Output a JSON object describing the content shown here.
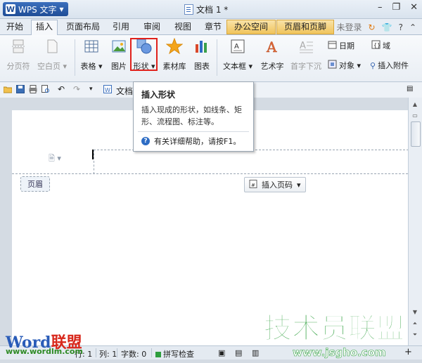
{
  "app": {
    "name": "WPS 文字",
    "doc_title": "文档 1 *"
  },
  "tabs": [
    {
      "label": "开始"
    },
    {
      "label": "插入"
    },
    {
      "label": "页面布局"
    },
    {
      "label": "引用"
    },
    {
      "label": "审阅"
    },
    {
      "label": "视图"
    },
    {
      "label": "章节"
    },
    {
      "label": "办公空间"
    },
    {
      "label": "页眉和页脚"
    }
  ],
  "account": {
    "login_label": "未登录"
  },
  "ribbon": {
    "page_break": "分页符",
    "blank_page": "空白页",
    "table": "表格",
    "picture": "图片",
    "shape": "形状",
    "material": "素材库",
    "chart": "图表",
    "textbox": "文本框",
    "wordart": "艺术字",
    "dropcap": "首字下沉",
    "date": "日期",
    "field": "域",
    "object": "对象",
    "attachment": "插入附件"
  },
  "quickbar": {
    "doc_tab_prefix": "文档"
  },
  "tooltip": {
    "title": "插入形状",
    "description": "插入现成的形状，如线条、矩形、流程图、标注等。",
    "help": "有关详细帮助，请按F1。"
  },
  "document": {
    "header_label": "页眉",
    "insert_page_number": "插入页码"
  },
  "status": {
    "line_label": "行: 1",
    "col_label": "列: 1",
    "word_count": "字数: 0",
    "spellcheck": "拼写检查"
  },
  "watermark": {
    "word_part1": "Word",
    "word_part2": "联盟",
    "url": "www.wordlm.com",
    "brand": "技术员联盟",
    "brand_url": "www.jsgho.com"
  },
  "colors": {
    "accent": "#1f4d96",
    "highlight_box": "#e0211b",
    "brand_green": "#2e9e3e",
    "word_blue": "#2a5cb8",
    "word_red": "#d8281c"
  }
}
